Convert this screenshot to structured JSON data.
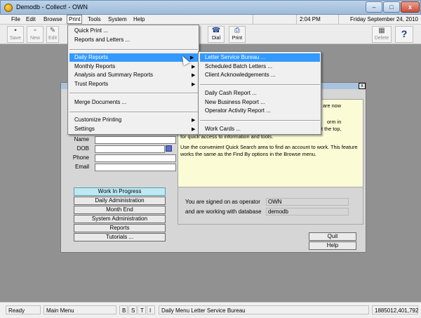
{
  "window": {
    "title": "Demodb - Collect! - OWN",
    "minimize_glyph": "–",
    "maximize_glyph": "□",
    "close_glyph": "x"
  },
  "menubar": {
    "items": [
      "File",
      "Edit",
      "Browse",
      "Print",
      "Tools",
      "System",
      "Help"
    ],
    "time": "2:04 PM",
    "date": "Friday  September 24, 2010"
  },
  "toolbar": {
    "save": "Save",
    "new": "New",
    "edit": "Edit",
    "dial": "Dial",
    "print": "Print",
    "delete": "Delete",
    "help_glyph": "?"
  },
  "print_menu": {
    "quick_print": "Quick Print ...",
    "reports_and_letters": "Reports and Letters ...",
    "daily_reports": "Daily Reports",
    "monthly_reports": "Monthly Reports",
    "analysis_reports": "Analysis and Summary Reports",
    "trust_reports": "Trust Reports",
    "merge_documents": "Merge Documents ...",
    "customize_printing": "Customize Printing",
    "settings": "Settings"
  },
  "daily_menu": {
    "letter_service_bureau": "Letter Service Bureau ...",
    "scheduled_batch_letters": "Scheduled Batch Letters ...",
    "client_acknowledgements": "Client Acknowledgements ...",
    "daily_cash_report": "Daily Cash Report ...",
    "new_business_report": "New Business Report ...",
    "operator_activity_report": "Operator Activity Report ...",
    "work_cards": "Work Cards ..."
  },
  "main_menu_window": {
    "close_glyph": "x",
    "message_fragment_1": "are now",
    "message_fragment_2": "orm in",
    "message_fragment_3": "at the top,",
    "message_line_1": "for quick access to information and tools.",
    "message_line_2": "Use the convenient Quick Search area to find an account to work. This feature works the same as the Find By options in the Browse menu.",
    "search_fields": [
      "Name",
      "DOB",
      "Phone",
      "Email"
    ],
    "nav_buttons": [
      "Work In Progress",
      "Daily Administration",
      "Month End",
      "System Administration",
      "Reports",
      "Tutorials ..."
    ],
    "signed_on_label": "You are signed on as operator",
    "database_label": "and are working with database",
    "operator": "OWN",
    "database": "demodb",
    "quit": "Quit",
    "help": "Help"
  },
  "statusbar": {
    "ready": "Ready",
    "menu": "Main Menu",
    "flags": [
      "B",
      "S",
      "T",
      "I"
    ],
    "context": "Daily Menu Letter Service Bureau",
    "record": "1885012,401,792"
  }
}
